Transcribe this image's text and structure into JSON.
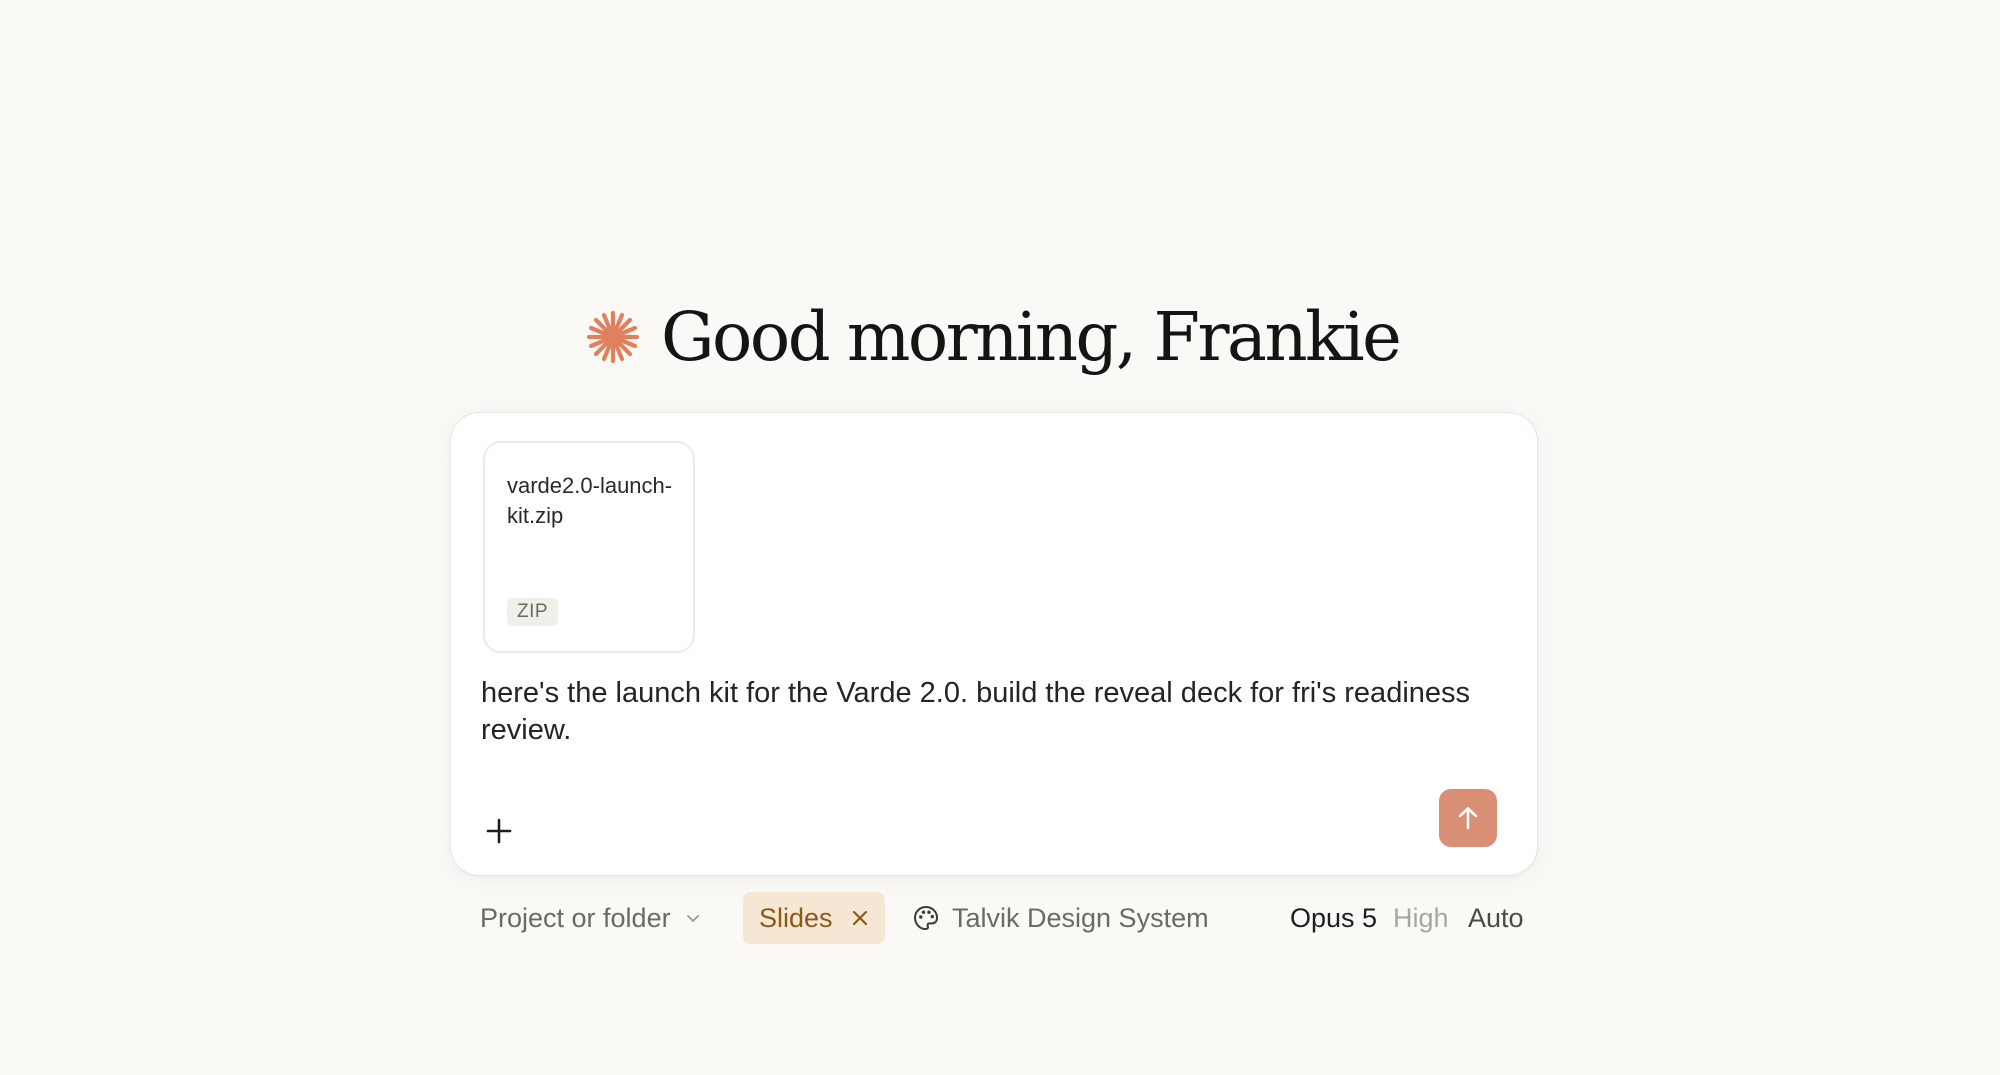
{
  "greeting": {
    "text": "Good morning, Frankie",
    "icon": "sparkle-star-icon",
    "icon_color": "#e0805f"
  },
  "composer": {
    "attachment": {
      "file_name": "varde2.0-launch-kit.zip",
      "file_type": "ZIP"
    },
    "prompt_text": "here's the launch kit for the Varde 2.0. build the reveal deck for fri's readiness review.",
    "add_icon": "plus-icon",
    "send_icon": "arrow-up-icon",
    "send_color": "#d98f76"
  },
  "toolbar": {
    "project_label": "Project or folder",
    "project_icon": "chevron-down-icon",
    "chip_label": "Slides",
    "chip_icon": "close-icon",
    "chip_color": "#f5e7d3",
    "design_system_label": "Talvik Design System",
    "design_system_icon": "palette-icon",
    "model_label": "Opus 5",
    "effort_label": "High",
    "mode_label": "Auto"
  }
}
